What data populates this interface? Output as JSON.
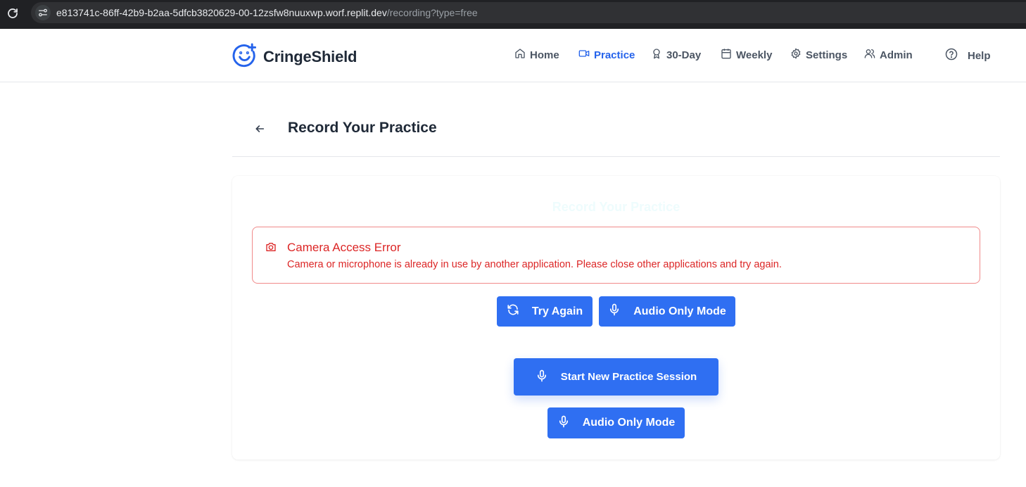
{
  "browser": {
    "url_host": "e813741c-86ff-42b9-b2aa-5dfcb3820629-00-12zsfw8nuuxwp.worf.replit.dev",
    "url_path": "/recording?type=free"
  },
  "header": {
    "brand": "CringeShield",
    "nav": [
      {
        "label": "Home",
        "icon": "home-icon"
      },
      {
        "label": "Practice",
        "icon": "video-icon",
        "active": true
      },
      {
        "label": "30-Day",
        "icon": "award-icon"
      },
      {
        "label": "Weekly",
        "icon": "calendar-icon"
      },
      {
        "label": "Settings",
        "icon": "gear-icon"
      },
      {
        "label": "Admin",
        "icon": "users-icon"
      },
      {
        "label": "Help",
        "icon": "help-circle-icon"
      }
    ]
  },
  "page": {
    "title": "Record Your Practice"
  },
  "card": {
    "title": "Record Your Practice",
    "alert": {
      "title": "Camera Access Error",
      "message": "Camera or microphone is already in use by another application. Please close other applications and try again."
    },
    "buttons": {
      "try_again": "Try Again",
      "audio_only_1": "Audio Only Mode",
      "start_session": "Start New Practice Session",
      "audio_only_2": "Audio Only Mode"
    }
  },
  "colors": {
    "accent": "#2f6ff2",
    "nav_active": "#2563eb",
    "error": "#dc2626",
    "error_border": "#f08a8a"
  }
}
